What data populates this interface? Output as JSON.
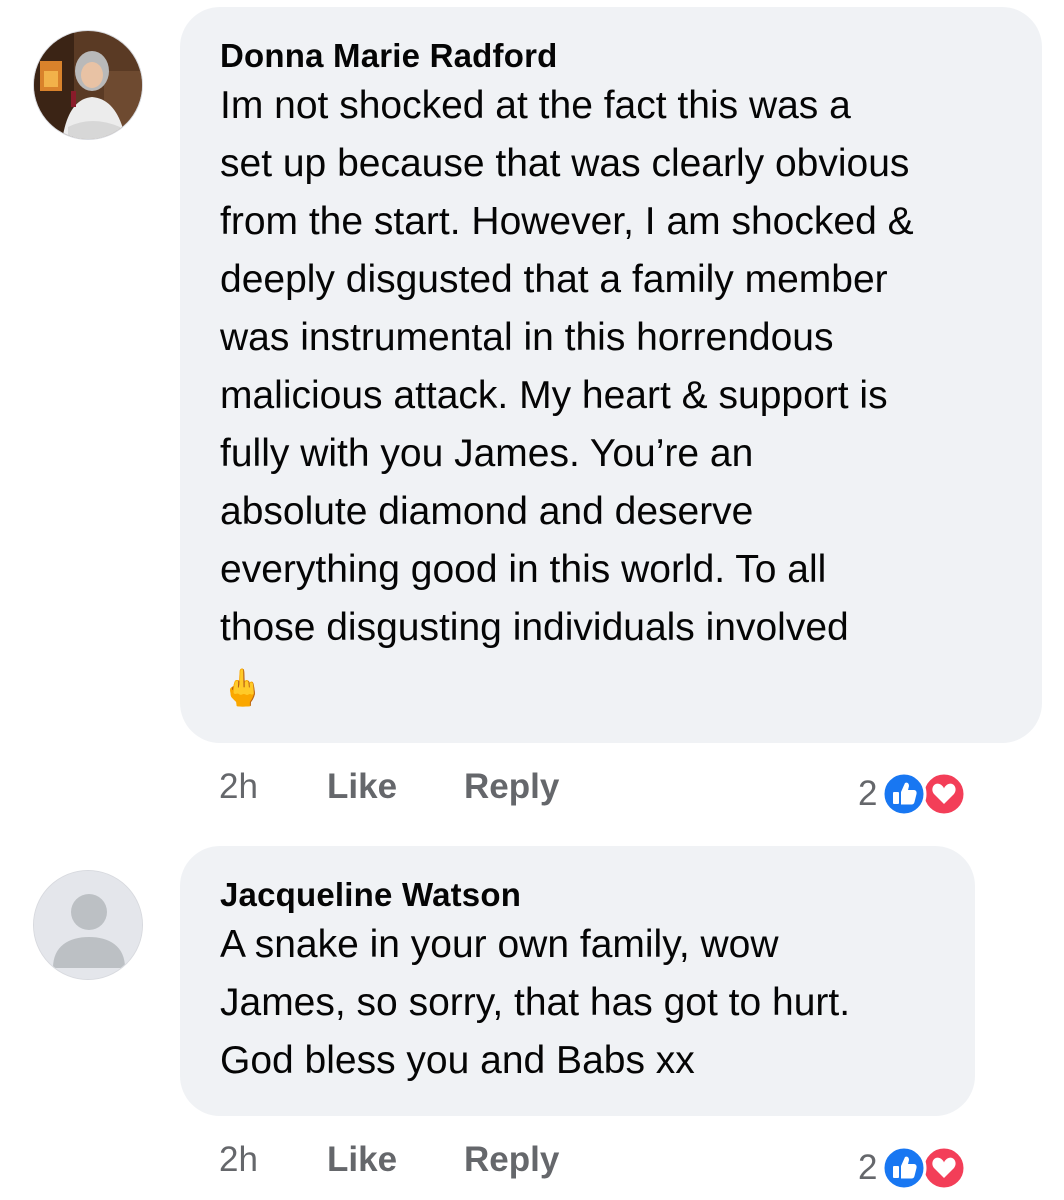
{
  "comments": [
    {
      "author": "Donna Marie Radford",
      "text": "Im not shocked at the fact this was a\nset up because that was clearly obvious\nfrom the start. However, I am shocked &\ndeeply disgusted that a family member\nwas instrumental in this horrendous\nmalicious attack. My heart & support is\nfully with you James. You’re an\nabsolute diamond and deserve\neverything good in this world. To all\nthose disgusting individuals involved",
      "emoji": "🖕",
      "avatar": "profile-photo",
      "time": "2h",
      "like_label": "Like",
      "reply_label": "Reply",
      "reaction_count": "2",
      "reactions": [
        "like-icon",
        "love-icon"
      ]
    },
    {
      "author": "Jacqueline Watson",
      "text": "A snake in your own family, wow\nJames, so sorry, that has got to hurt.\nGod bless you and Babs xx",
      "avatar": "default-avatar",
      "time": "2h",
      "like_label": "Like",
      "reply_label": "Reply",
      "reaction_count": "2",
      "reactions": [
        "like-icon",
        "love-icon"
      ]
    }
  ],
  "colors": {
    "bubble": "#f0f2f5",
    "meta_text": "#65676b",
    "like_blue": "#1877f2",
    "love_red": "#f33e58"
  }
}
